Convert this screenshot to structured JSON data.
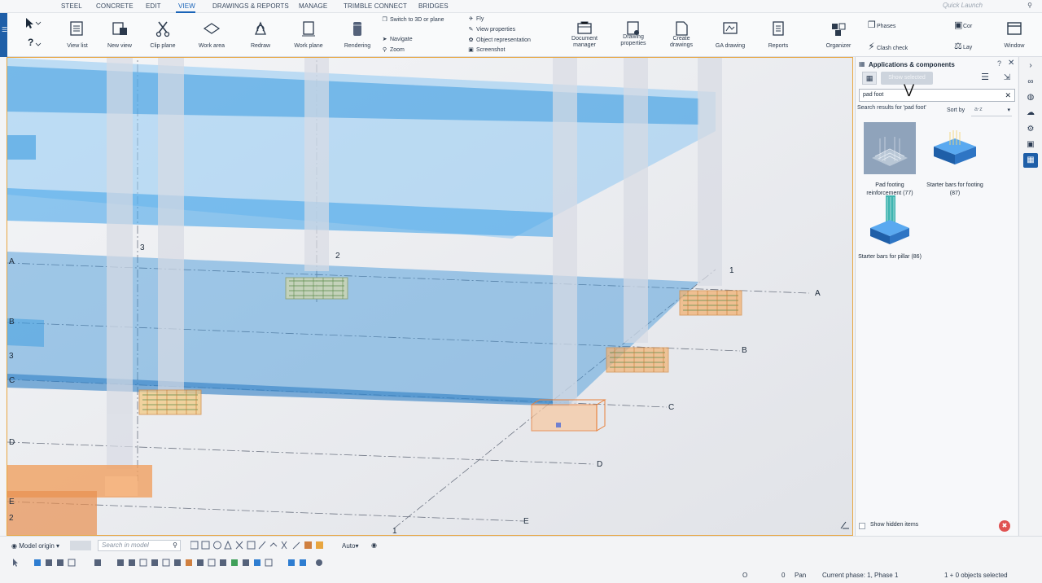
{
  "menu": {
    "tabs": [
      "STEEL",
      "CONCRETE",
      "EDIT",
      "VIEW",
      "DRAWINGS & REPORTS",
      "MANAGE",
      "TRIMBLE CONNECT",
      "BRIDGES"
    ],
    "active_tab": "VIEW",
    "quick_launch_placeholder": "Quick Launch"
  },
  "ribbon": {
    "view_list": "View list",
    "new_view": "New view",
    "clip_plane": "Clip plane",
    "work_area": "Work area",
    "redraw": "Redraw",
    "work_plane": "Work plane",
    "rendering": "Rendering",
    "switch_3d": "Switch to 3D or plane",
    "navigate": "Navigate",
    "zoom": "Zoom",
    "fly": "Fly",
    "view_properties": "View properties",
    "object_representation": "Object representation",
    "screenshot": "Screenshot",
    "document_manager": "Document manager",
    "drawing_properties": "Drawing properties",
    "create_drawings": "Create drawings",
    "ga_drawing": "GA drawing",
    "reports": "Reports",
    "organizer": "Organizer",
    "phases": "Phases",
    "clash_check": "Clash check",
    "cor": "Cor",
    "lay": "Lay",
    "window": "Window"
  },
  "viewport": {
    "grid_labels_left": [
      "A",
      "B",
      "3",
      "C",
      "D",
      "E",
      "2"
    ],
    "grid_labels_right": [
      "A",
      "B",
      "C",
      "D",
      "E"
    ],
    "axis_numbers": [
      "3",
      "2",
      "1",
      "1"
    ]
  },
  "panel": {
    "title": "Applications & components",
    "show_selected": "Show selected",
    "search_value": "pad foot",
    "results_text": "Search results for 'pad foot'",
    "sort_label": "Sort by",
    "sort_value": "a-z",
    "cards": [
      {
        "label": "Pad footing reinforcement (77)",
        "icon": "pad-footing-reinforcement-icon"
      },
      {
        "label": "Starter bars for footing (87)",
        "icon": "starter-bars-footing-icon"
      },
      {
        "label": "Starter bars for pillar (86)",
        "icon": "starter-bars-pillar-icon"
      }
    ],
    "show_hidden": "Show hidden items"
  },
  "bottom": {
    "model_origin": "Model origin",
    "search_placeholder": "Search in model",
    "auto": "Auto"
  },
  "status": {
    "o": "O",
    "zero": "0",
    "pan": "Pan",
    "phase": "Current phase: 1, Phase 1",
    "selected": "1 + 0 objects selected"
  },
  "colors": {
    "accent": "#1f5fa8",
    "slab": "#3a9be0",
    "footing": "#f0a060"
  }
}
